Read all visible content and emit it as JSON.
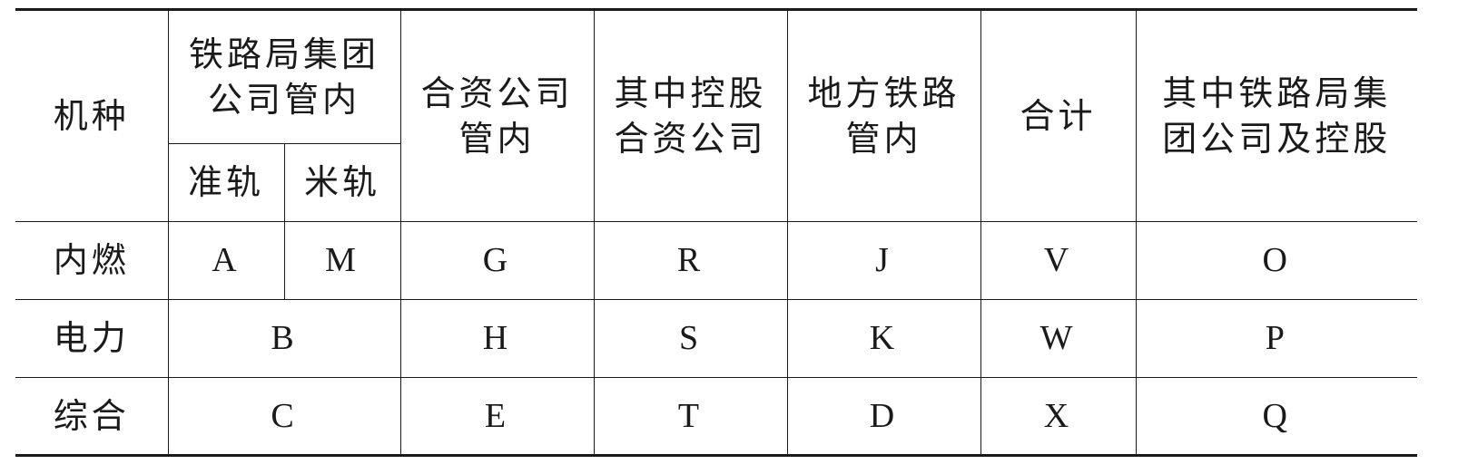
{
  "table": {
    "header": {
      "type": "机种",
      "railway_group_line1": "铁路局集团",
      "railway_group_line2": "公司管内",
      "standard_gauge": "准轨",
      "meter_gauge": "米轨",
      "jv_line1": "合资公司",
      "jv_line2": "管内",
      "controlled_jv_line1": "其中控股",
      "controlled_jv_line2": "合资公司",
      "local_line1": "地方铁路",
      "local_line2": "管内",
      "total": "合计",
      "group_and_controlled_line1": "其中铁路局集",
      "group_and_controlled_line2": "团公司及控股"
    },
    "rows": [
      {
        "type": "内燃",
        "standard": "A",
        "meter": "M",
        "jv": "G",
        "controlled_jv": "R",
        "local": "J",
        "total": "V",
        "group_controlled": "O"
      },
      {
        "type": "电力",
        "group": "B",
        "jv": "H",
        "controlled_jv": "S",
        "local": "K",
        "total": "W",
        "group_controlled": "P"
      },
      {
        "type": "综合",
        "group": "C",
        "jv": "E",
        "controlled_jv": "T",
        "local": "D",
        "total": "X",
        "group_controlled": "Q"
      }
    ]
  }
}
